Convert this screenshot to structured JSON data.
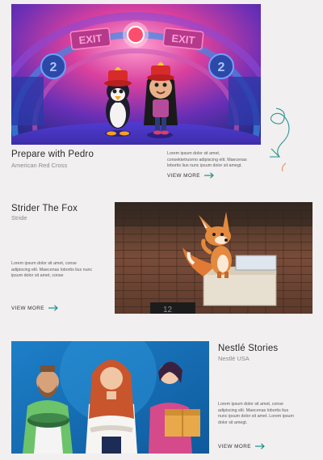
{
  "projects": [
    {
      "title": "Prepare with Pedro",
      "client": "American Red Cross",
      "description": "Lorem ipsum dolor sit amet, consektetruorno adipiscing elit. Maecenas lobortis lius nunc ipsum dolor sit amegt.",
      "link_label": "VIEW MORE",
      "sign_left": "EXIT",
      "sign_right": "EXIT",
      "wall_number_left": "2",
      "wall_number_right": "2"
    },
    {
      "title": "Strider The Fox",
      "client": "Stride",
      "description": "Lorem ipsum dolor sit amet, conse adipiscing elit. Maecenas lobortis lius nunc ipsum dolor sit amet, conse",
      "link_label": "VIEW MORE",
      "box_label": "12"
    },
    {
      "title": "Nestlé Stories",
      "client": "Nestlé USA",
      "description": "Lorem ipsum dolor sit amet, conse adipiscing elit. Maecenas lobortis lius nunc ipsum dolor sit amet. Lorem ipsum dolor sit amegt.",
      "link_label": "VIEW MORE"
    }
  ],
  "colors": {
    "accent": "#1f8f8a",
    "background": "#f1efef"
  },
  "icons": {
    "view_more": "arrow-right-icon",
    "decoration": "squiggle-doodle-icon"
  }
}
